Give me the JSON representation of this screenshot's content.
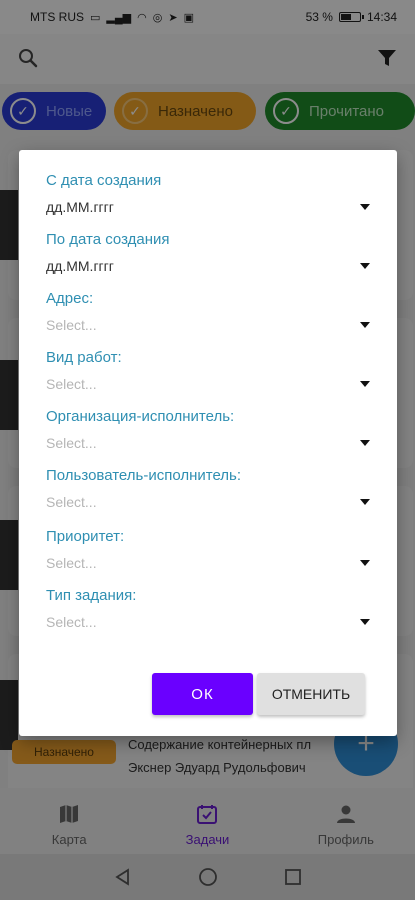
{
  "status_bar": {
    "carrier": "MTS RUS",
    "battery": "53 %",
    "time": "14:34"
  },
  "app_bar": {
    "search_icon": "search-icon",
    "filter_icon": "filter-icon"
  },
  "chips": [
    {
      "label": "Новые",
      "color": "#2b3bd6"
    },
    {
      "label": "Назначено",
      "color": "#f0a428"
    },
    {
      "label": "Прочитано",
      "color": "#1f8a2b"
    }
  ],
  "background_card": {
    "badge": "Назначено",
    "title": "Содержание контейнерных пл",
    "user": "Экснер Эдуард Рудольфович"
  },
  "fab": {
    "label": "+"
  },
  "dialog": {
    "fields": [
      {
        "label": "С дата создания",
        "value": "дд.ММ.гггг"
      },
      {
        "label": "По дата создания",
        "value": "дд.ММ.гггг"
      },
      {
        "label": "Адрес:",
        "value": "Select..."
      },
      {
        "label": "Вид работ:",
        "value": "Select..."
      },
      {
        "label": "Организация-исполнитель:",
        "value": "Select..."
      },
      {
        "label": "Пользователь-исполнитель:",
        "value": "Select..."
      },
      {
        "label": "Приоритет:",
        "value": "Select..."
      },
      {
        "label": "Тип задания:",
        "value": "Select..."
      }
    ],
    "ok_label": "ОК",
    "cancel_label": "ОТМЕНИТЬ",
    "accent_color": "#6a00ff",
    "label_color": "#2f8fb2"
  },
  "bottom_nav": [
    {
      "label": "Карта",
      "icon": "map-icon"
    },
    {
      "label": "Задачи",
      "icon": "tasks-icon"
    },
    {
      "label": "Профиль",
      "icon": "profile-icon"
    }
  ]
}
